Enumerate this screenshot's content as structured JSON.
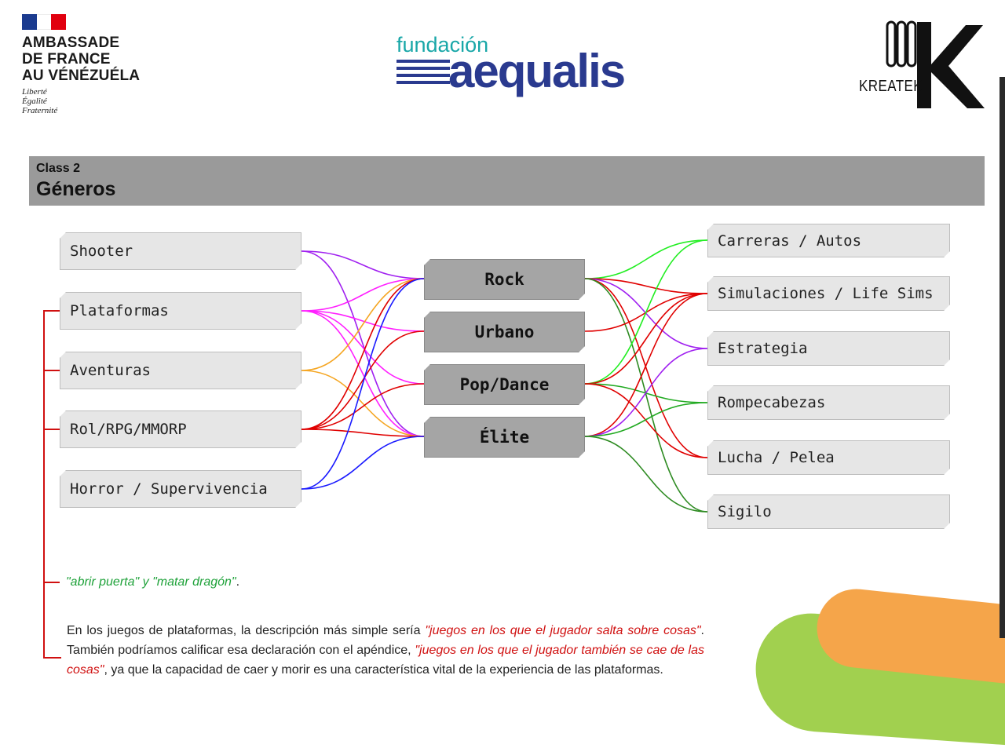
{
  "logos": {
    "ambassade": {
      "title_lines": [
        "AMBASSADE",
        "DE FRANCE",
        "AU VÉNÉZUÉLA"
      ],
      "motto_lines": [
        "Liberté",
        "Égalité",
        "Fraternité"
      ],
      "flag_colors": [
        "#1b3b8f",
        "#ffffff",
        "#e1000f"
      ]
    },
    "fundacion": {
      "small": "fundación",
      "big": "aequalis",
      "teal": "#19a7a8",
      "navy": "#2a3a8f"
    },
    "kreatek": {
      "text": "KREATEK"
    }
  },
  "header": {
    "subtitle": "Class 2",
    "title": "Géneros"
  },
  "diagram": {
    "left_nodes": [
      "Shooter",
      "Plataformas",
      "Aventuras",
      "Rol/RPG/MMORP",
      "Horror / Supervivencia"
    ],
    "middle_nodes": [
      "Rock",
      "Urbano",
      "Pop/Dance",
      "Élite"
    ],
    "right_nodes": [
      "Carreras / Autos",
      "Simulaciones / Life Sims",
      "Estrategia",
      "Rompecabezas",
      "Lucha / Pelea",
      "Sigilo"
    ],
    "left_links": [
      {
        "from": 0,
        "to": 0,
        "color": "#a020f0"
      },
      {
        "from": 0,
        "to": 3,
        "color": "#a020f0"
      },
      {
        "from": 1,
        "to": 0,
        "color": "#ff20ff"
      },
      {
        "from": 1,
        "to": 1,
        "color": "#ff20ff"
      },
      {
        "from": 1,
        "to": 2,
        "color": "#ff20ff"
      },
      {
        "from": 1,
        "to": 3,
        "color": "#ff20ff"
      },
      {
        "from": 2,
        "to": 0,
        "color": "#f5a623"
      },
      {
        "from": 2,
        "to": 3,
        "color": "#f5a623"
      },
      {
        "from": 3,
        "to": 0,
        "color": "#e00000"
      },
      {
        "from": 3,
        "to": 1,
        "color": "#e00000"
      },
      {
        "from": 3,
        "to": 2,
        "color": "#e00000"
      },
      {
        "from": 3,
        "to": 3,
        "color": "#e00000"
      },
      {
        "from": 4,
        "to": 0,
        "color": "#1a1aff"
      },
      {
        "from": 4,
        "to": 3,
        "color": "#1a1aff"
      }
    ],
    "right_links": [
      {
        "from": 0,
        "to": 0,
        "color": "#22ee22"
      },
      {
        "from": 0,
        "to": 1,
        "color": "#e00000"
      },
      {
        "from": 0,
        "to": 2,
        "color": "#a020f0"
      },
      {
        "from": 0,
        "to": 4,
        "color": "#e00000"
      },
      {
        "from": 0,
        "to": 5,
        "color": "#2e8b22"
      },
      {
        "from": 1,
        "to": 1,
        "color": "#e00000"
      },
      {
        "from": 2,
        "to": 0,
        "color": "#22ee22"
      },
      {
        "from": 2,
        "to": 1,
        "color": "#e00000"
      },
      {
        "from": 2,
        "to": 3,
        "color": "#22aa22"
      },
      {
        "from": 2,
        "to": 4,
        "color": "#e00000"
      },
      {
        "from": 3,
        "to": 1,
        "color": "#e00000"
      },
      {
        "from": 3,
        "to": 2,
        "color": "#a020f0"
      },
      {
        "from": 3,
        "to": 3,
        "color": "#22aa22"
      },
      {
        "from": 3,
        "to": 5,
        "color": "#2e8b22"
      }
    ],
    "bracket_color": "#d01010"
  },
  "notes": {
    "quote_green_1": "\"abrir puerta\" y \"matar dragón\"",
    "quote_end": ".",
    "para_1": "En los juegos de plataformas, la descripción más simple sería ",
    "para_red_1": "\"juegos en los que el jugador salta sobre cosas\"",
    "para_2": ". También podríamos calificar esa declaración con el apéndice, ",
    "para_red_2": "\"juegos en los que el jugador también se cae de las cosas\"",
    "para_3": ", ya que la capacidad de caer y morir es una característica vital de la experiencia de las plataformas."
  }
}
